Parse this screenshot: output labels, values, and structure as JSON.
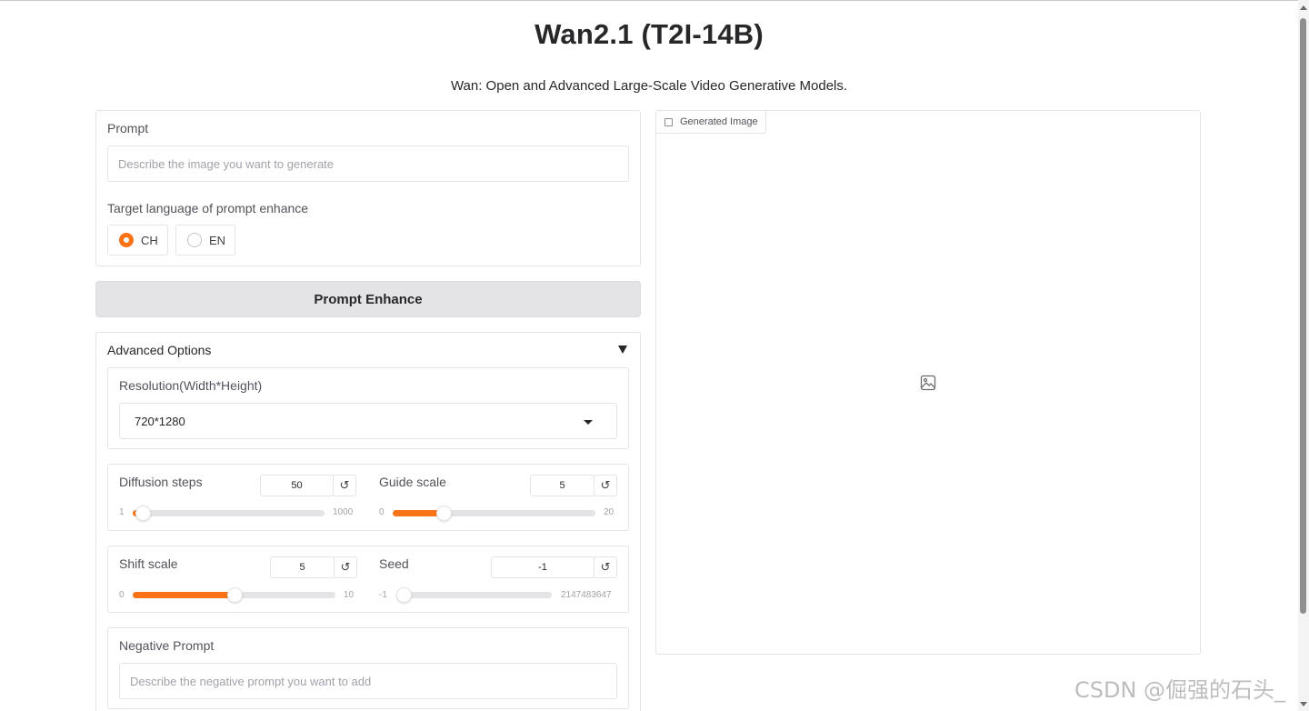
{
  "app": {
    "title": "Wan2.1 (T2I-14B)",
    "subtitle": "Wan: Open and Advanced Large-Scale Video Generative Models."
  },
  "prompt": {
    "label": "Prompt",
    "placeholder": "Describe the image you want to generate"
  },
  "language": {
    "label": "Target language of prompt enhance",
    "options": [
      "CH",
      "EN"
    ],
    "selected": "CH"
  },
  "enhance_button": "Prompt Enhance",
  "advanced": {
    "label": "Advanced Options",
    "resolution": {
      "label": "Resolution(Width*Height)",
      "value": "720*1280"
    },
    "diffusion_steps": {
      "label": "Diffusion steps",
      "value": "50",
      "min": "1",
      "max": "1000",
      "fraction": 0.05
    },
    "guide_scale": {
      "label": "Guide scale",
      "value": "5",
      "min": "0",
      "max": "20",
      "fraction": 0.25
    },
    "shift_scale": {
      "label": "Shift scale",
      "value": "5",
      "min": "0",
      "max": "10",
      "fraction": 0.5
    },
    "seed": {
      "label": "Seed",
      "value": "-1",
      "min": "-1",
      "max": "2147483647",
      "fraction": 0.0
    },
    "negative_prompt": {
      "label": "Negative Prompt",
      "placeholder": "Describe the negative prompt you want to add"
    }
  },
  "output": {
    "label": "Generated Image"
  },
  "icons": {
    "reset": "↺",
    "image": "image-icon"
  },
  "watermark": "CSDN @倔强的石头_",
  "colors": {
    "accent": "#f97316",
    "button_bg": "#e4e4e7"
  }
}
